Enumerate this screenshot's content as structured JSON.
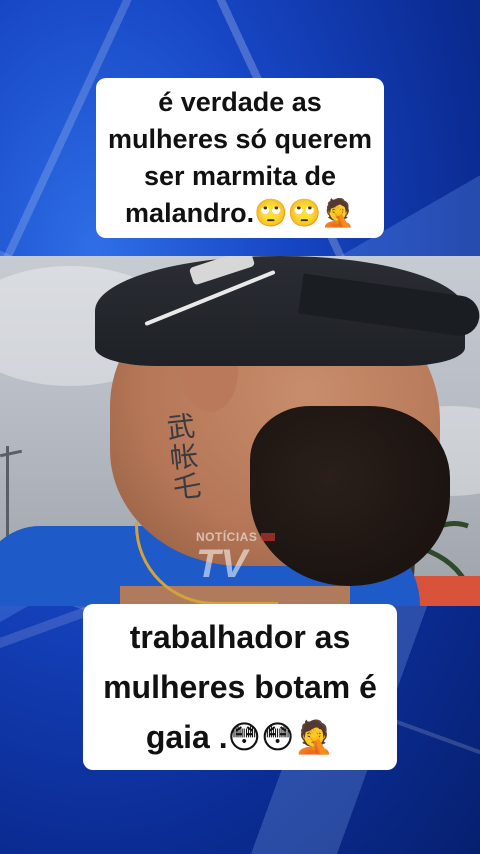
{
  "caption_top": {
    "lines": [
      "é verdade as",
      "mulheres só querem",
      "ser marmita de",
      "malandro.🙄🙄🤦"
    ]
  },
  "caption_bottom": {
    "lines": [
      "trabalhador as",
      "mulheres botam é",
      "gaia .😳😳🤦"
    ]
  },
  "video": {
    "watermark_small": "NOTÍCIAS",
    "watermark_big": "TV",
    "tattoo_glyphs": "武\n帐\n乇"
  },
  "colors": {
    "background_blue": "#1746c4",
    "caption_bg": "#ffffff",
    "caption_text": "#111111",
    "shirt_blue": "#1e5bc8"
  }
}
